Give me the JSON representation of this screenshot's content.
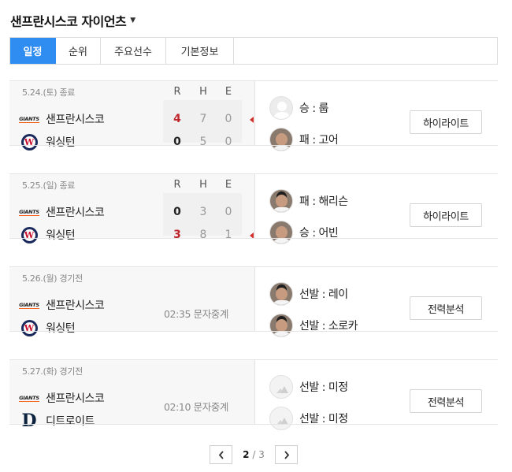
{
  "header": {
    "title": "샌프란시스코 자이언츠",
    "dropdown_icon": "caret-down-icon"
  },
  "tabs": [
    {
      "label": "일정",
      "active": true
    },
    {
      "label": "순위",
      "active": false
    },
    {
      "label": "주요선수",
      "active": false
    },
    {
      "label": "기본정보",
      "active": false
    }
  ],
  "rhe_headers": [
    "R",
    "H",
    "E"
  ],
  "games": [
    {
      "date": "5.24.(토) 종료",
      "teams": [
        {
          "name": "샌프란시스코",
          "logo": "giants-logo",
          "logo_text": "GIANTS",
          "scores": [
            "4",
            "7",
            "0"
          ],
          "winner": true
        },
        {
          "name": "워싱턴",
          "logo": "nationals-logo",
          "logo_text": "W",
          "scores": [
            "0",
            "5",
            "0"
          ],
          "winner": false
        }
      ],
      "pitchers": [
        {
          "label": "승 : 룹",
          "avatar": "silhouette"
        },
        {
          "label": "패 : 고어",
          "avatar": "photo"
        }
      ],
      "button": "하이라이트"
    },
    {
      "date": "5.25.(일) 종료",
      "teams": [
        {
          "name": "샌프란시스코",
          "logo": "giants-logo",
          "logo_text": "GIANTS",
          "scores": [
            "0",
            "3",
            "0"
          ],
          "winner": false
        },
        {
          "name": "워싱턴",
          "logo": "nationals-logo",
          "logo_text": "W",
          "scores": [
            "3",
            "8",
            "1"
          ],
          "winner": true
        }
      ],
      "pitchers": [
        {
          "label": "패 : 해리슨",
          "avatar": "photo"
        },
        {
          "label": "승 : 어빈",
          "avatar": "photo"
        }
      ],
      "button": "하이라이트"
    },
    {
      "date": "5.26.(월) 경기전",
      "status": "02:35 문자중계",
      "teams": [
        {
          "name": "샌프란시스코",
          "logo": "giants-logo",
          "logo_text": "GIANTS"
        },
        {
          "name": "워싱턴",
          "logo": "nationals-logo",
          "logo_text": "W"
        }
      ],
      "pitchers": [
        {
          "label": "선발 : 레이",
          "avatar": "photo"
        },
        {
          "label": "선발 : 소로카",
          "avatar": "photo"
        }
      ],
      "button": "전력분석"
    },
    {
      "date": "5.27.(화) 경기전",
      "status": "02:10 문자중계",
      "teams": [
        {
          "name": "샌프란시스코",
          "logo": "giants-logo",
          "logo_text": "GIANTS"
        },
        {
          "name": "디트로이트",
          "logo": "tigers-logo",
          "logo_text": "D"
        }
      ],
      "pitchers": [
        {
          "label": "선발 : 미정",
          "avatar": "none"
        },
        {
          "label": "선발 : 미정",
          "avatar": "none"
        }
      ],
      "button": "전력분석"
    }
  ],
  "pagination": {
    "current": "2",
    "separator": "/",
    "total": "3",
    "prev_icon": "chevron-left-icon",
    "next_icon": "chevron-right-icon"
  },
  "colors": {
    "accent": "#2f8cf0",
    "win_score": "#c0262d",
    "win_marker": "#d32f2f"
  }
}
